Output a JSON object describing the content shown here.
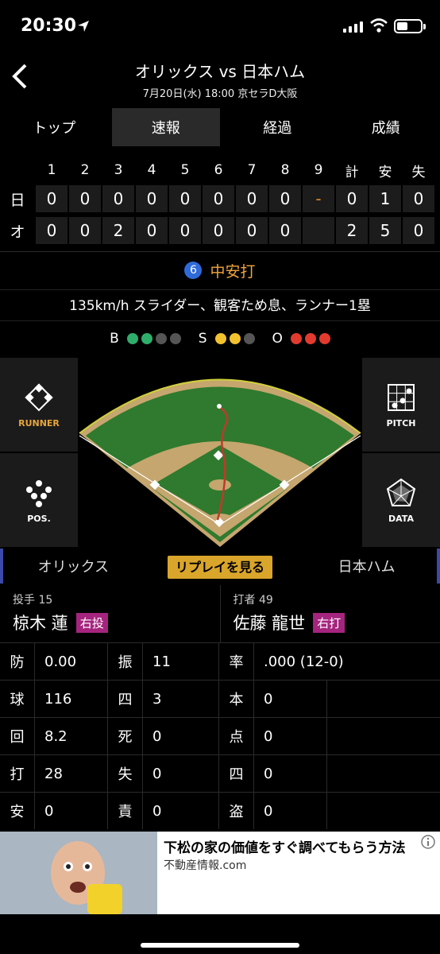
{
  "status": {
    "time": "20:30"
  },
  "header": {
    "title": "オリックス vs 日本ハム",
    "subtitle": "7月20日(水) 18:00 京セラD大阪"
  },
  "tabs": [
    "トップ",
    "速報",
    "経過",
    "成績"
  ],
  "active_tab": "速報",
  "scoreboard": {
    "headers": [
      "1",
      "2",
      "3",
      "4",
      "5",
      "6",
      "7",
      "8",
      "9",
      "計",
      "安",
      "失"
    ],
    "rows": [
      {
        "team": "日",
        "innings": [
          "0",
          "0",
          "0",
          "0",
          "0",
          "0",
          "0",
          "0",
          "-"
        ],
        "totals": [
          "0",
          "1",
          "0"
        ]
      },
      {
        "team": "オ",
        "innings": [
          "0",
          "0",
          "2",
          "0",
          "0",
          "0",
          "0",
          "0",
          ""
        ],
        "totals": [
          "2",
          "5",
          "0"
        ]
      }
    ]
  },
  "play": {
    "batter_number": "6",
    "result": "中安打",
    "description": "135km/h スライダー、観客ため息、ランナー1塁"
  },
  "count": {
    "balls_label": "B",
    "balls": 2,
    "strikes_label": "S",
    "strikes": 2,
    "outs_label": "O",
    "outs": 3,
    "colors": {
      "ball": "#2fae6b",
      "strike": "#f2c12e",
      "out": "#e23b2e",
      "off": "#555555"
    }
  },
  "field_buttons": {
    "runner": "RUNNER",
    "position": "POS.",
    "pitch": "PITCH",
    "data": "DATA"
  },
  "team_switch": {
    "left": "オリックス",
    "replay": "リプレイを見る",
    "right": "日本ハム"
  },
  "pitcher": {
    "role": "投手 15",
    "name": "椋木 蓮",
    "badge": "右投"
  },
  "batter": {
    "role": "打者 49",
    "name": "佐藤 龍世",
    "badge": "右打"
  },
  "pitcher_stats": [
    {
      "k1": "防",
      "v1": "0.00",
      "k2": "振",
      "v2": "11"
    },
    {
      "k1": "球",
      "v1": "116",
      "k2": "四",
      "v2": "3"
    },
    {
      "k1": "回",
      "v1": "8.2",
      "k2": "死",
      "v2": "0"
    },
    {
      "k1": "打",
      "v1": "28",
      "k2": "失",
      "v2": "0"
    },
    {
      "k1": "安",
      "v1": "0",
      "k2": "責",
      "v2": "0"
    }
  ],
  "batter_stats": [
    {
      "k": "率",
      "v": ".000 (12-0)"
    },
    {
      "k": "本",
      "v": "0"
    },
    {
      "k": "点",
      "v": "0"
    },
    {
      "k": "四",
      "v": "0"
    },
    {
      "k": "盗",
      "v": "0"
    }
  ],
  "ad": {
    "title": "下松の家の価値をすぐ調べてもらう方法",
    "source": "不動産情報.com"
  }
}
